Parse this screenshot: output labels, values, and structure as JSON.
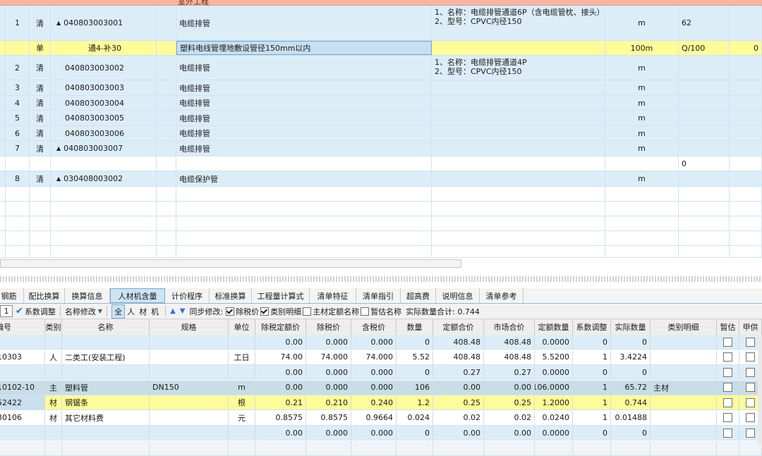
{
  "upper_table": {
    "partial_top_text": "室外工程",
    "rows": [
      {
        "no": "1",
        "type": "清",
        "code": "040803003001",
        "code_expand": "▲",
        "name": "电缆排管",
        "feature": [
          "1、名称：电缆排管通道6P（含电缆管枕、接头）",
          "2、型号：CPVC内径150"
        ],
        "unit": "m",
        "qty": "62",
        "extra": ""
      },
      {
        "no": "",
        "type": "单",
        "code": "通4-补30",
        "code_expand": "",
        "name": "塑料电线管埋地敷设管径150mm以内",
        "feature": [],
        "unit": "100m",
        "qty": "Q/100",
        "extra": "0"
      },
      {
        "no": "2",
        "type": "清",
        "code": "040803003002",
        "code_expand": "",
        "name": "电缆排管",
        "feature": [
          "1、名称：电缆排管通道4P",
          "2、型号：CPVC内径150"
        ],
        "unit": "m",
        "qty": "",
        "extra": ""
      },
      {
        "no": "3",
        "type": "清",
        "code": "040803003003",
        "code_expand": "",
        "name": "电缆排管",
        "feature": [],
        "unit": "m",
        "qty": "",
        "extra": ""
      },
      {
        "no": "4",
        "type": "清",
        "code": "040803003004",
        "code_expand": "",
        "name": "电缆排管",
        "feature": [],
        "unit": "m",
        "qty": "",
        "extra": ""
      },
      {
        "no": "5",
        "type": "清",
        "code": "040803003005",
        "code_expand": "",
        "name": "电缆排管",
        "feature": [],
        "unit": "m",
        "qty": "",
        "extra": ""
      },
      {
        "no": "6",
        "type": "清",
        "code": "040803003006",
        "code_expand": "",
        "name": "电缆排管",
        "feature": [],
        "unit": "m",
        "qty": "",
        "extra": ""
      },
      {
        "no": "7",
        "type": "清",
        "code": "040803003007",
        "code_expand": "▲",
        "name": "电缆排管",
        "feature": [],
        "unit": "m",
        "qty": "",
        "extra": ""
      },
      {
        "no": "",
        "type": "",
        "code": "",
        "code_expand": "",
        "name": "",
        "feature": [],
        "unit": "",
        "qty": "0",
        "extra": ""
      },
      {
        "no": "8",
        "type": "清",
        "code": "030408003002",
        "code_expand": "▲",
        "name": "电缆保护管",
        "feature": [],
        "unit": "m",
        "qty": "",
        "extra": ""
      }
    ]
  },
  "tabs": [
    "钢筋",
    "配比换算",
    "换算信息",
    "人材机含量",
    "计价程序",
    "标准换算",
    "工程量计算式",
    "清单特征",
    "清单指引",
    "超高费",
    "说明信息",
    "清单参考"
  ],
  "active_tab": "人材机含量",
  "toolbar": {
    "spin_value": "1",
    "coef_adjust": "系数调整",
    "name_modify": "名称修改",
    "filters": [
      "全",
      "人",
      "材",
      "机"
    ],
    "sync_label": "同步修改:",
    "opt_tax": "除税价",
    "opt_category": "类别明细",
    "opt_main_name": "主材定额名称",
    "opt_estimate": "暂估名称",
    "actual_total": "实际数量合计: 0.744"
  },
  "lower_table": {
    "headers": [
      "编号",
      "类别",
      "名称",
      "规格",
      "单位",
      "除税定额价",
      "除税价",
      "含税价",
      "数量",
      "定额合价",
      "市场合价",
      "定额数量",
      "系数调整",
      "实际数量",
      "类别明细",
      "暂估",
      "甲供"
    ],
    "rows": [
      {
        "code": "",
        "type": "",
        "name": "",
        "spec": "",
        "unit": "",
        "p1": "0.00",
        "p2": "0.000",
        "p3": "0.000",
        "qty": "0",
        "sum1": "408.48",
        "sum2": "408.48",
        "dq": "0.0000",
        "coef": "0",
        "act": "0",
        "cat": ""
      },
      {
        "code": "10303",
        "type": "人",
        "name": "二类工(安装工程)",
        "spec": "",
        "unit": "工日",
        "p1": "74.00",
        "p2": "74.000",
        "p3": "74.000",
        "qty": "5.52",
        "sum1": "408.48",
        "sum2": "408.48",
        "dq": "5.5200",
        "coef": "1",
        "act": "3.4224",
        "cat": ""
      },
      {
        "code": "",
        "type": "",
        "name": "",
        "spec": "",
        "unit": "",
        "p1": "0.00",
        "p2": "0.000",
        "p3": "0.000",
        "qty": "0",
        "sum1": "0.27",
        "sum2": "0.27",
        "dq": "0.0000",
        "coef": "0",
        "act": "0",
        "cat": ""
      },
      {
        "code": "10102-10",
        "type": "主",
        "name": "塑料管",
        "spec": "DN150",
        "unit": "m",
        "p1": "0.00",
        "p2": "0.000",
        "p3": "0.000",
        "qty": "106",
        "sum1": "0.00",
        "sum2": "0.00",
        "dq": "106.0000",
        "coef": "1",
        "act": "65.72",
        "cat": "主材"
      },
      {
        "code": "52422",
        "type": "材",
        "name": "钢锯条",
        "spec": "",
        "unit": "根",
        "p1": "0.21",
        "p2": "0.210",
        "p3": "0.240",
        "qty": "1.2",
        "sum1": "0.25",
        "sum2": "0.25",
        "dq": "1.2000",
        "coef": "1",
        "act": "0.744",
        "cat": ""
      },
      {
        "code": "30106",
        "type": "材",
        "name": "其它材料费",
        "spec": "",
        "unit": "元",
        "p1": "0.8575",
        "p2": "0.8575",
        "p3": "0.9664",
        "qty": "0.024",
        "sum1": "0.02",
        "sum2": "0.02",
        "dq": "0.0240",
        "coef": "1",
        "act": "0.01488",
        "cat": ""
      },
      {
        "code": "",
        "type": "",
        "name": "",
        "spec": "",
        "unit": "",
        "p1": "0.00",
        "p2": "0.000",
        "p3": "0.000",
        "qty": "0",
        "sum1": "0.00",
        "sum2": "0.00",
        "dq": "0.0000",
        "coef": "0",
        "act": "0",
        "cat": ""
      },
      {
        "code": "",
        "type": "",
        "name": "",
        "spec": "",
        "unit": "",
        "p1": "",
        "p2": "",
        "p3": "",
        "qty": "",
        "sum1": "",
        "sum2": "",
        "dq": "",
        "coef": "",
        "act": "",
        "cat": ""
      }
    ]
  },
  "colors": {
    "row_blue": "#dcedf8",
    "row_yellow": "#fdfb9a",
    "row_highlight": "#c9dff0",
    "top_band": "#f6b6a2",
    "row_main": "#c8dde6"
  }
}
